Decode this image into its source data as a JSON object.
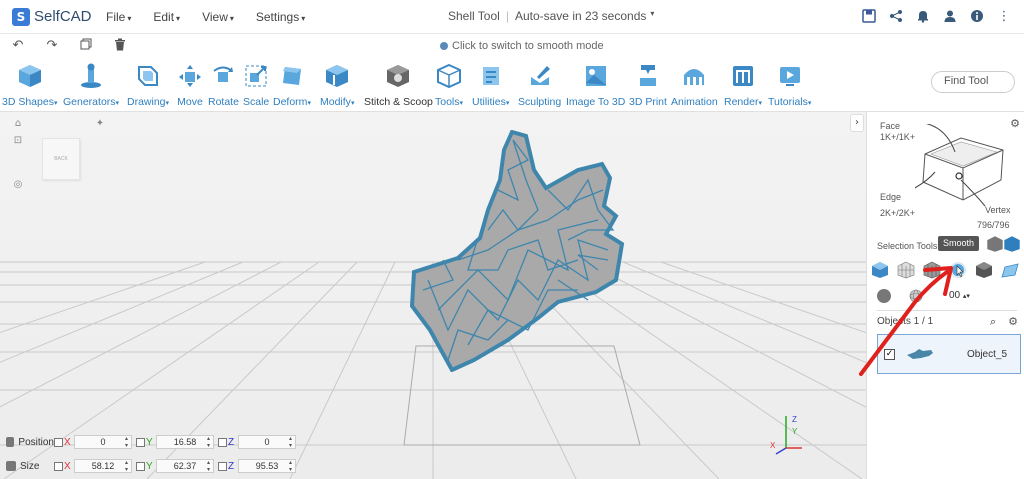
{
  "app": {
    "logo_text": "SelfCAD",
    "menu": [
      "File",
      "Edit",
      "View",
      "Settings"
    ],
    "doc_title": "Shell Tool",
    "autosave": "Auto-save in 23 seconds",
    "hint": "Click to switch to smooth mode"
  },
  "toolbar": {
    "items": [
      {
        "label": "3D Shapes",
        "icon": "cube-icon"
      },
      {
        "label": "Generators",
        "icon": "generators-icon"
      },
      {
        "label": "Drawing",
        "icon": "drawing-icon"
      },
      {
        "label": "Move",
        "icon": "move-icon"
      },
      {
        "label": "Rotate",
        "icon": "rotate-icon"
      },
      {
        "label": "Scale",
        "icon": "scale-icon"
      },
      {
        "label": "Deform",
        "icon": "deform-icon"
      },
      {
        "label": "Modify",
        "icon": "modify-icon"
      },
      {
        "label": "Stitch & Scoop",
        "icon": "stitch-scoop-icon"
      },
      {
        "label": "Tools",
        "icon": "tools-icon"
      },
      {
        "label": "Utilities",
        "icon": "utilities-icon"
      },
      {
        "label": "Sculpting",
        "icon": "sculpting-icon"
      },
      {
        "label": "Image To 3D",
        "icon": "image-to-3d-icon"
      },
      {
        "label": "3D Print",
        "icon": "3d-print-icon"
      },
      {
        "label": "Animation",
        "icon": "animation-icon"
      },
      {
        "label": "Render",
        "icon": "render-icon"
      },
      {
        "label": "Tutorials",
        "icon": "tutorials-icon"
      }
    ],
    "find_placeholder": "Find Tool"
  },
  "viewport": {
    "nav_cube_face": "BACK",
    "position_label": "Position",
    "size_label": "Size",
    "position": {
      "x": "0",
      "y": "16.58",
      "z": "0"
    },
    "size": {
      "x": "58.12",
      "y": "62.37",
      "z": "95.53"
    },
    "axis_x": "X",
    "axis_y": "Y",
    "axis_z": "Z"
  },
  "panel": {
    "face_label": "Face",
    "face_count": "1K+/1K+",
    "edge_label": "Edge",
    "edge_count": "2K+/2K+",
    "vertex_label": "Vertex",
    "vertex_count": "796/796",
    "selection_tools": "Selection Tools",
    "tooltip": "Smooth",
    "size_value": "00",
    "objects_header": "Objects 1 / 1",
    "object_name": "Object_5"
  },
  "colors": {
    "accent": "#2f7fbf",
    "mesh": "#4a86a8",
    "annotation": "#e0201c"
  }
}
